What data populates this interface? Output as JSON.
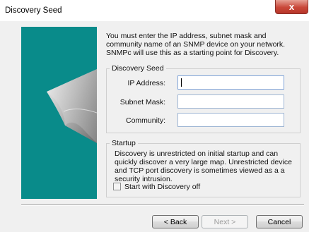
{
  "window": {
    "title": "Discovery Seed",
    "close_glyph": "x"
  },
  "intro_text": "You must enter the IP address, subnet mask and community name of an SNMP device on your network. SNMPc will use this as a starting point for Discovery.",
  "seed_group": {
    "label": "Discovery Seed",
    "ip_label": "IP Address:",
    "ip_value": "",
    "mask_label": "Subnet Mask:",
    "mask_value": "",
    "community_label": "Community:",
    "community_value": ""
  },
  "startup_group": {
    "label": "Startup",
    "description": "Discovery is unrestricted on initial startup and can quickly discover a very large map.  Unrestricted device and TCP port discovery is sometimes viewed as a a security intrusion.",
    "checkbox_label": "Start with Discovery off",
    "checkbox_checked": false
  },
  "buttons": {
    "back": "< Back",
    "next": "Next >",
    "cancel": "Cancel"
  },
  "colors": {
    "panel": "#098b8a",
    "close": "#c9483a"
  }
}
